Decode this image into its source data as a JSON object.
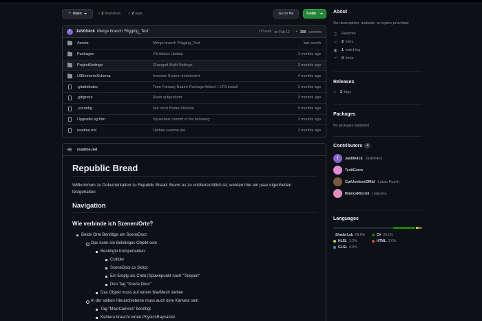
{
  "toolbar": {
    "branch": "main",
    "branches_count": "2",
    "branches_label": "branches",
    "tags_count": "2",
    "tags_label": "tags",
    "goto_label": "Go to file",
    "code_label": "Code"
  },
  "commit": {
    "avatar_glyph": "!",
    "author": "JaN0h4ck",
    "message": "Merge branch 'Rigging_Test'",
    "hash": "3f7ae69",
    "date": "on Feb 12",
    "commits_count": "309",
    "commits_label": "commits"
  },
  "files": [
    {
      "type": "folder",
      "name": "Assets",
      "message": "Merge branch 'Rigging_Test'",
      "date": "last month"
    },
    {
      "type": "folder",
      "name": "Packages",
      "message": "VS Addon Update",
      "date": "2 months ago"
    },
    {
      "type": "folder",
      "name": "ProjectSettings",
      "message": "Changed Build Settings",
      "date": "2 months ago"
    },
    {
      "type": "folder",
      "name": "UIElementsSchema",
      "message": "Inventar-System funktioniert",
      "date": "4 months ago"
    },
    {
      "type": "file",
      "name": ".gitattributes",
      "message": "Toon Fantasy Nature Package Added + LFS install",
      "date": "2 months ago"
    },
    {
      "type": "file",
      "name": ".gitignore",
      "message": "Repo aufgeräumt",
      "date": "2 months ago"
    },
    {
      "type": "file",
      "name": ".vsconfig",
      "message": "Nur noch Boden klickbar",
      "date": "5 months ago"
    },
    {
      "type": "file",
      "name": "UpgradeLog.htm",
      "message": "Squashed commit of the following:",
      "date": "3 months ago"
    },
    {
      "type": "file",
      "name": "readme.md",
      "message": "Update readme.md",
      "date": "2 months ago"
    }
  ],
  "readme": {
    "filename": "readme.md",
    "h1": "Republic Bread",
    "intro": "Willkommen zu Dokumentation zu Republic Bread. Bevor es zu unübersichtlich ist, werden hier ein paar eigenheiten festgehalten.",
    "h2": "Navigation",
    "h3": "Wie verbinde ich Szenen/Orte?",
    "l1_a": "Beide Orte Benötige ein SceneDoor",
    "l2_a": "Das kann ein Beliebiges Objekt sein",
    "l3_a": "Benötigte Komponenten:",
    "l4_a": "Collider",
    "l4_b": "SceneDoor.cs Skript",
    "l4_c": "Ein Empty als Child (Spawnpunkt nach \"Teleport\"",
    "l4_d": "Den Tag \"Scene Door\"",
    "l3_b": "Das Objekt muss auf einem NavMesh stehen",
    "l2_b": "In der selben Hierarchiebene muss auch eine Kamera sein",
    "l3_c": "Tag \"MainCamera\" benötigt",
    "l3_d": "Kamera braucht einen PhysicsRaycaster"
  },
  "about": {
    "title": "About",
    "description": "No description, website, or topics provided.",
    "readme_label": "Readme",
    "stars_count": "2",
    "stars_label": "stars",
    "watching_count": "1",
    "watching_label": "watching",
    "forks_count": "0",
    "forks_label": "forks"
  },
  "releases": {
    "title": "Releases",
    "tags_count": "2",
    "tags_label": "tags"
  },
  "packages": {
    "title": "Packages",
    "text": "No packages published"
  },
  "contributors": {
    "title": "Contributors",
    "count": "4",
    "people": [
      {
        "login": "JaN0h4ck",
        "name": "JaN0h4ck",
        "color": "#8a63d2",
        "glyph": "!"
      },
      {
        "login": "TrollGerm",
        "name": "",
        "color": "#e48bd4",
        "glyph": ""
      },
      {
        "login": "CptUselessDMld",
        "name": "Lukas Pusch",
        "color": "#7a5c3a",
        "glyph": ""
      },
      {
        "login": "BiancaRizzoli",
        "name": "Lyquaria",
        "color": "#e58bbd",
        "glyph": ""
      }
    ]
  },
  "languages": {
    "title": "Languages",
    "items": [
      {
        "name": "ShaderLab",
        "pct": "68.6%",
        "value": 68.6,
        "color": "#222c37"
      },
      {
        "name": "C#",
        "pct": "26.1%",
        "value": 26.1,
        "color": "#178600"
      },
      {
        "name": "HLSL",
        "pct": "3.2%",
        "value": 3.2,
        "color": "#aace60"
      },
      {
        "name": "HTML",
        "pct": "1.6%",
        "value": 1.6,
        "color": "#e34c26"
      },
      {
        "name": "GLSL",
        "pct": "0.5%",
        "value": 0.5,
        "color": "#5686a5"
      }
    ]
  }
}
